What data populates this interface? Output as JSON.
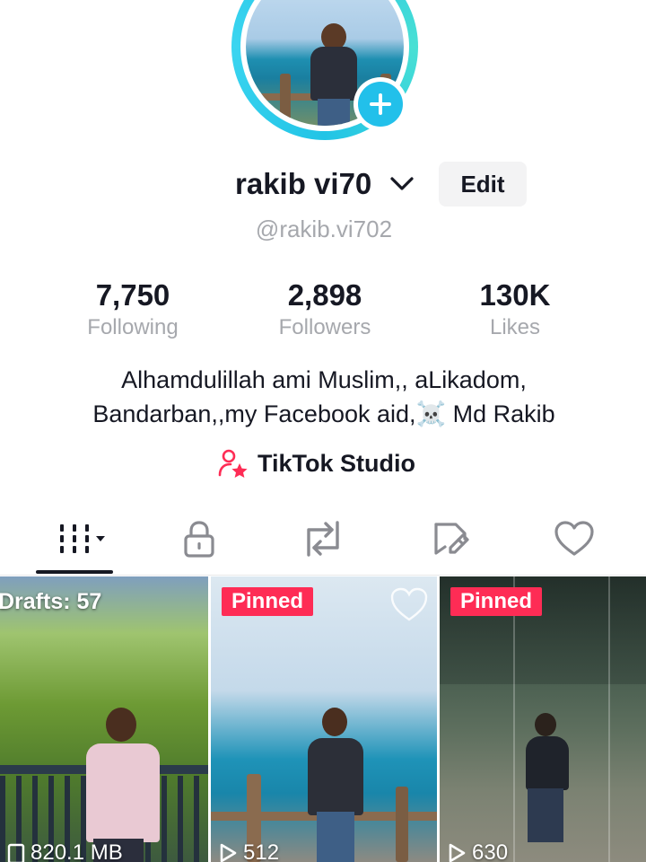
{
  "profile": {
    "display_name": "rakib vi70",
    "edit_label": "Edit",
    "username": "@rakib.vi702",
    "avatar_icon": "profile-photo",
    "add_icon": "plus-icon"
  },
  "stats": [
    {
      "value": "7,750",
      "label": "Following"
    },
    {
      "value": "2,898",
      "label": "Followers"
    },
    {
      "value": "130K",
      "label": "Likes"
    }
  ],
  "bio": {
    "line1": "Alhamdulillah ami Muslim,, aLikadom,",
    "line2": "Bandarban,,my Facebook aid,☠️ Md Rakib"
  },
  "studio": {
    "label": "TikTok Studio",
    "icon": "creator-star-icon"
  },
  "tabs": [
    {
      "icon": "videos-grid-icon",
      "active": true
    },
    {
      "icon": "lock-icon",
      "active": false
    },
    {
      "icon": "repost-icon",
      "active": false
    },
    {
      "icon": "favorites-icon",
      "active": false
    },
    {
      "icon": "heart-icon",
      "active": false
    }
  ],
  "videos": [
    {
      "overlay": "Drafts: 57",
      "stat": "820.1 MB"
    },
    {
      "overlay": "Pinned",
      "stat": "512"
    },
    {
      "overlay": "Pinned",
      "stat": "630"
    }
  ],
  "colors": {
    "accent_pink": "#fe2c55",
    "ring_cyan": "#22c4e6",
    "muted_text": "#a6a8ad"
  }
}
